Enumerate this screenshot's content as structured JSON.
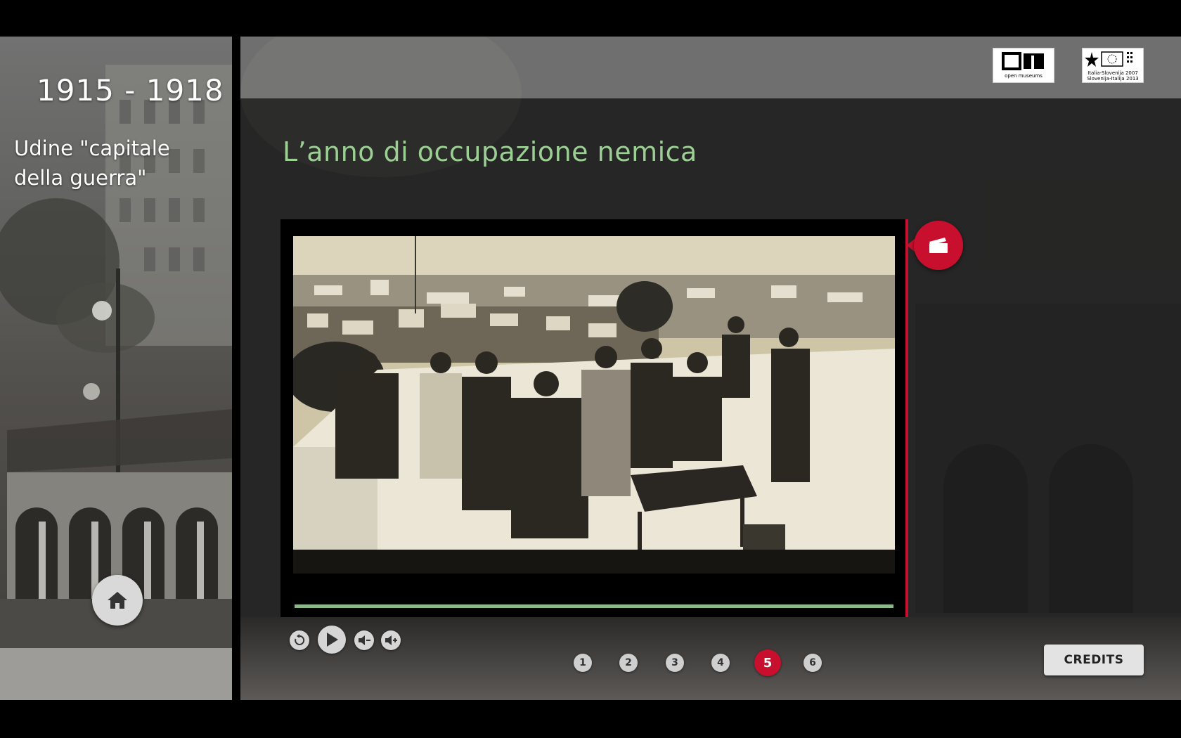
{
  "sidebar": {
    "era": "1915 - 1918",
    "subtitle": "Udine \"capitale della guerra\"",
    "home_icon": "home-icon"
  },
  "header": {
    "logos": [
      {
        "name": "open-museums-logo",
        "caption": "open museums"
      },
      {
        "name": "interreg-logo",
        "caption": "Italia-Slovenija 2007\nSlovenija-Italija 2013"
      }
    ]
  },
  "main": {
    "title": "L’anno di occupazione nemica",
    "video": {
      "image": "archival photograph of officers on a rooftop overlooking the city",
      "progress": 1.0,
      "clip_icon": "clapperboard-icon"
    }
  },
  "controls": {
    "replay_icon": "replay-icon",
    "play_icon": "play-icon",
    "volume_down_icon": "volume-down-icon",
    "volume_up_icon": "volume-up-icon"
  },
  "pagination": {
    "pages": [
      "1",
      "2",
      "3",
      "4",
      "5",
      "6"
    ],
    "active": "5"
  },
  "credits_label": "CREDITS",
  "colors": {
    "accent_red": "#c8102e",
    "title_green": "#9ccf93",
    "progress_green": "#8ab888"
  }
}
